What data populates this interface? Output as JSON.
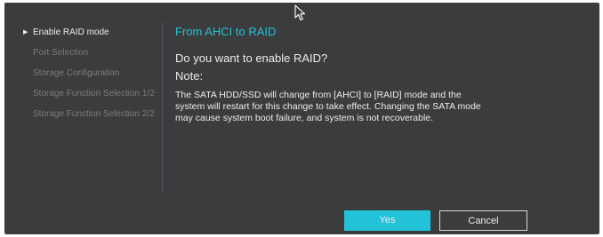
{
  "sidebar": {
    "items": [
      {
        "label": "Enable RAID mode",
        "active": true
      },
      {
        "label": "Port Selection",
        "active": false
      },
      {
        "label": "Storage Configuration",
        "active": false
      },
      {
        "label": "Storage Function Selection 1/2",
        "active": false
      },
      {
        "label": "Storage Function Selection 2/2",
        "active": false
      }
    ],
    "active_marker_icon": "triangle-right-icon"
  },
  "content": {
    "heading": "From AHCI to RAID",
    "question": "Do you want to enable RAID?",
    "note_label": "Note:",
    "message": "The SATA HDD/SSD will change from [AHCI] to [RAID] mode and the system will restart for this change to take effect. Changing the SATA mode may cause system boot failure, and system is not recoverable."
  },
  "buttons": {
    "yes_label": "Yes",
    "cancel_label": "Cancel"
  },
  "colors": {
    "background": "#3b3c3e",
    "accent": "#24c2d8",
    "text": "#ececec",
    "muted_text": "#7b7c7e"
  },
  "icons": {
    "pointer": "mouse-pointer-icon"
  }
}
